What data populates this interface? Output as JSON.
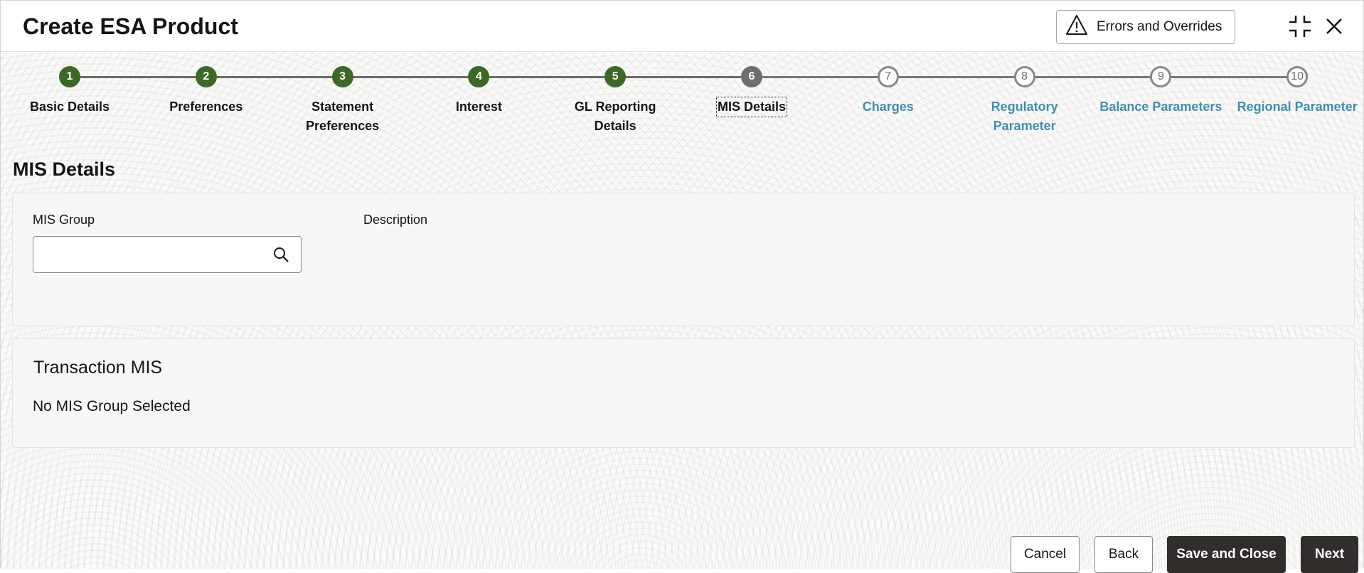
{
  "header": {
    "title": "Create ESA Product",
    "errors_button_label": "Errors and Overrides"
  },
  "stepper": {
    "steps": [
      {
        "number": "1",
        "label": "Basic Details",
        "state": "done"
      },
      {
        "number": "2",
        "label": "Preferences",
        "state": "done"
      },
      {
        "number": "3",
        "label": "Statement\nPreferences",
        "state": "done"
      },
      {
        "number": "4",
        "label": "Interest",
        "state": "done"
      },
      {
        "number": "5",
        "label": "GL Reporting\nDetails",
        "state": "done"
      },
      {
        "number": "6",
        "label": "MIS Details",
        "state": "current"
      },
      {
        "number": "7",
        "label": "Charges",
        "state": "future"
      },
      {
        "number": "8",
        "label": "Regulatory\nParameter",
        "state": "future"
      },
      {
        "number": "9",
        "label": "Balance Parameters",
        "state": "future"
      },
      {
        "number": "10",
        "label": "Regional Parameter",
        "state": "future"
      }
    ]
  },
  "main": {
    "section_title": "MIS Details",
    "mis_group_label": "MIS Group",
    "mis_group_value": "",
    "description_label": "Description",
    "transaction_heading": "Transaction MIS",
    "transaction_empty_text": "No MIS Group Selected"
  },
  "footer": {
    "cancel_label": "Cancel",
    "back_label": "Back",
    "save_close_label": "Save and Close",
    "next_label": "Next"
  },
  "colors": {
    "step_done": "#3a6a25",
    "step_current": "#6f6e6b",
    "step_future_text": "#3e8fb0",
    "primary_button": "#312d2a"
  }
}
